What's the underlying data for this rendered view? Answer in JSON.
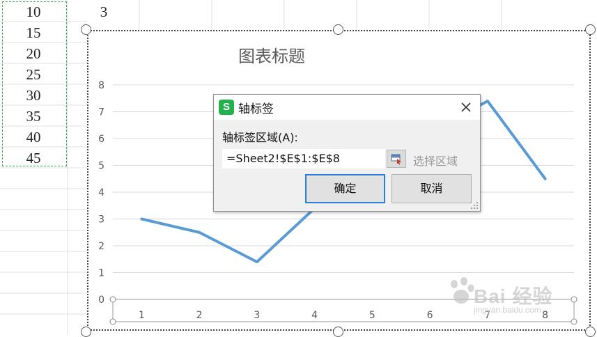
{
  "sheet": {
    "column_a_values": [
      "10",
      "15",
      "20",
      "25",
      "30",
      "35",
      "40",
      "45"
    ],
    "column_b_value": "3"
  },
  "chart": {
    "title": "图表标题"
  },
  "chart_data": {
    "type": "line",
    "title": "图表标题",
    "xlabel": "",
    "ylabel": "",
    "x": [
      1,
      2,
      3,
      4,
      5,
      6,
      7,
      8
    ],
    "x_tick_labels": [
      "1",
      "2",
      "3",
      "4",
      "5",
      "6",
      "7",
      "8"
    ],
    "y_tick_labels": [
      "0",
      "1",
      "2",
      "3",
      "4",
      "5",
      "6",
      "7",
      "8"
    ],
    "series": [
      {
        "values": [
          3,
          2.5,
          1.4,
          3.4,
          5.3,
          6.2,
          7.4,
          4.5
        ],
        "color": "#5b9bd5"
      }
    ],
    "ylim": [
      0,
      8
    ],
    "grid": true,
    "legend": "none"
  },
  "dialog": {
    "app_icon_letter": "S",
    "title": "轴标签",
    "field_label": "轴标签区域(A):",
    "input_value": "=Sheet2!$E$1:$E$8",
    "select_range_label": "选择区域",
    "ok_label": "确定",
    "cancel_label": "取消",
    "close_icon": "close-icon",
    "range_picker_icon": "range-picker-icon"
  },
  "watermark": {
    "brand": "Bai 经验",
    "url": "jingyan.baidu.com"
  },
  "colors": {
    "series": "#5b9bd5",
    "selection_border": "#3aa453",
    "ok_border": "#2a7fd4",
    "app_icon": "#22b14c"
  }
}
